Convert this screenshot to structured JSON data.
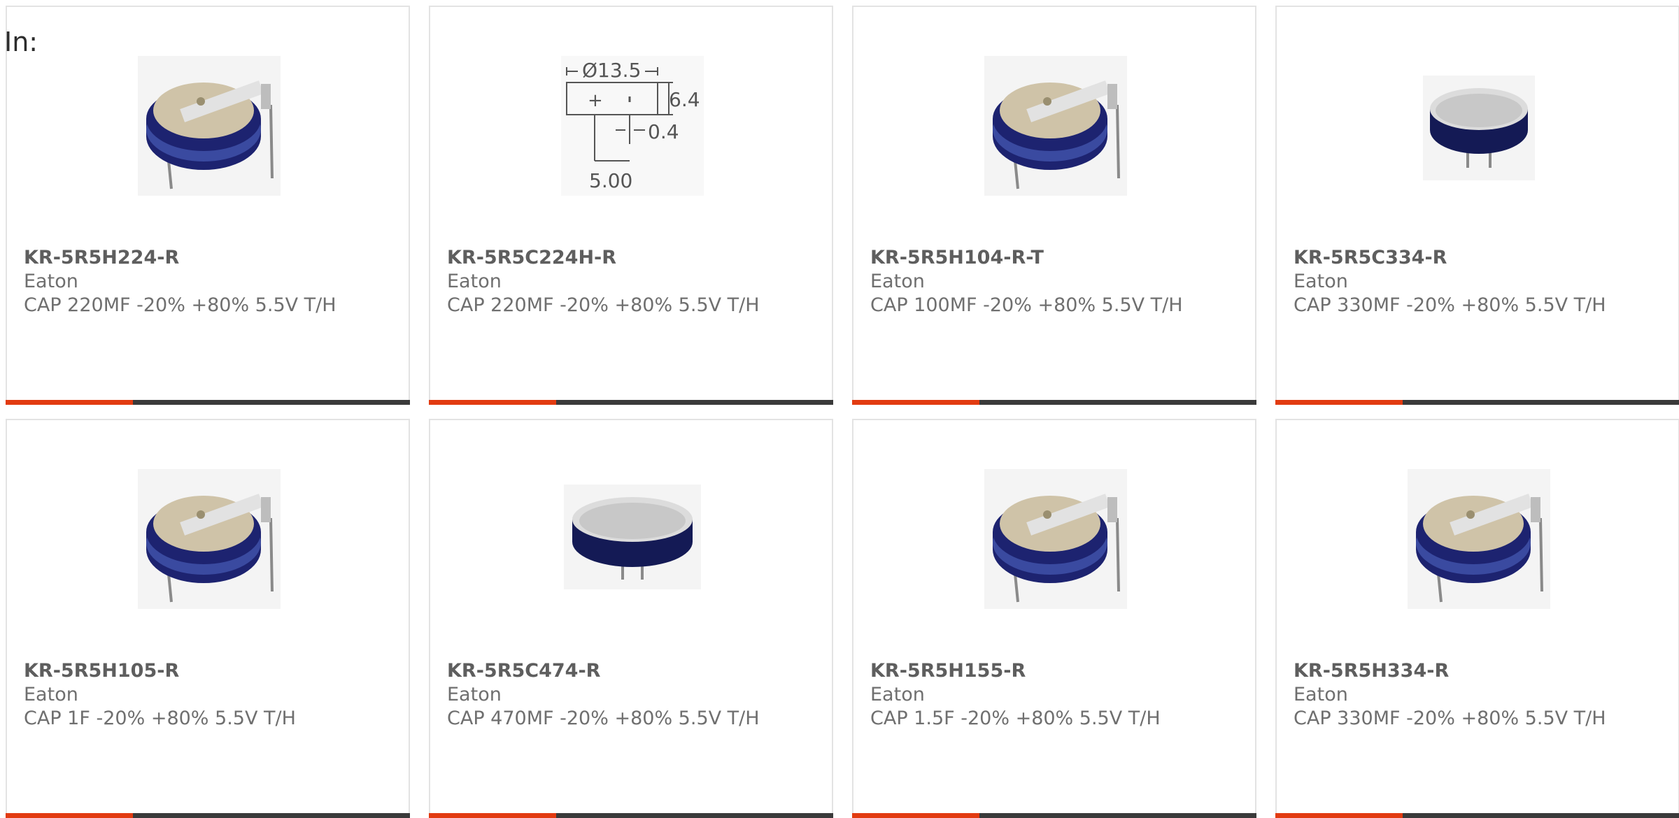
{
  "filter_label": "In:",
  "colors": {
    "accent": "#e23b11",
    "bar": "#3a3a3a",
    "card_border": "#e3e3e3",
    "capacitor_body": "#1d2370"
  },
  "products": [
    {
      "part_number": "KR-5R5H224-R",
      "manufacturer": "Eaton",
      "description": "CAP 220MF -20% +80% 5.5V T/H",
      "image": "capacitor-horizontal-tab-icon"
    },
    {
      "part_number": "KR-5R5C224H-R",
      "manufacturer": "Eaton",
      "description": "CAP 220MF -20% +80% 5.5V T/H",
      "image": "dimension-drawing-icon",
      "drawing": {
        "diameter": "Ø13.5",
        "height": "6.4",
        "lead": "0.4",
        "pitch": "5.00",
        "plus": "+"
      }
    },
    {
      "part_number": "KR-5R5H104-R-T",
      "manufacturer": "Eaton",
      "description": "CAP 100MF -20% +80% 5.5V T/H",
      "image": "capacitor-horizontal-tab-icon"
    },
    {
      "part_number": "KR-5R5C334-R",
      "manufacturer": "Eaton",
      "description": "CAP 330MF -20% +80% 5.5V T/H",
      "image": "capacitor-coin-icon"
    },
    {
      "part_number": "KR-5R5H105-R",
      "manufacturer": "Eaton",
      "description": "CAP 1F -20% +80% 5.5V T/H",
      "image": "capacitor-horizontal-tab-icon"
    },
    {
      "part_number": "KR-5R5C474-R",
      "manufacturer": "Eaton",
      "description": "CAP 470MF -20% +80% 5.5V T/H",
      "image": "capacitor-coin-icon"
    },
    {
      "part_number": "KR-5R5H155-R",
      "manufacturer": "Eaton",
      "description": "CAP 1.5F -20% +80% 5.5V T/H",
      "image": "capacitor-horizontal-tab-icon"
    },
    {
      "part_number": "KR-5R5H334-R",
      "manufacturer": "Eaton",
      "description": "CAP 330MF -20% +80% 5.5V T/H",
      "image": "capacitor-horizontal-tab-icon"
    }
  ]
}
